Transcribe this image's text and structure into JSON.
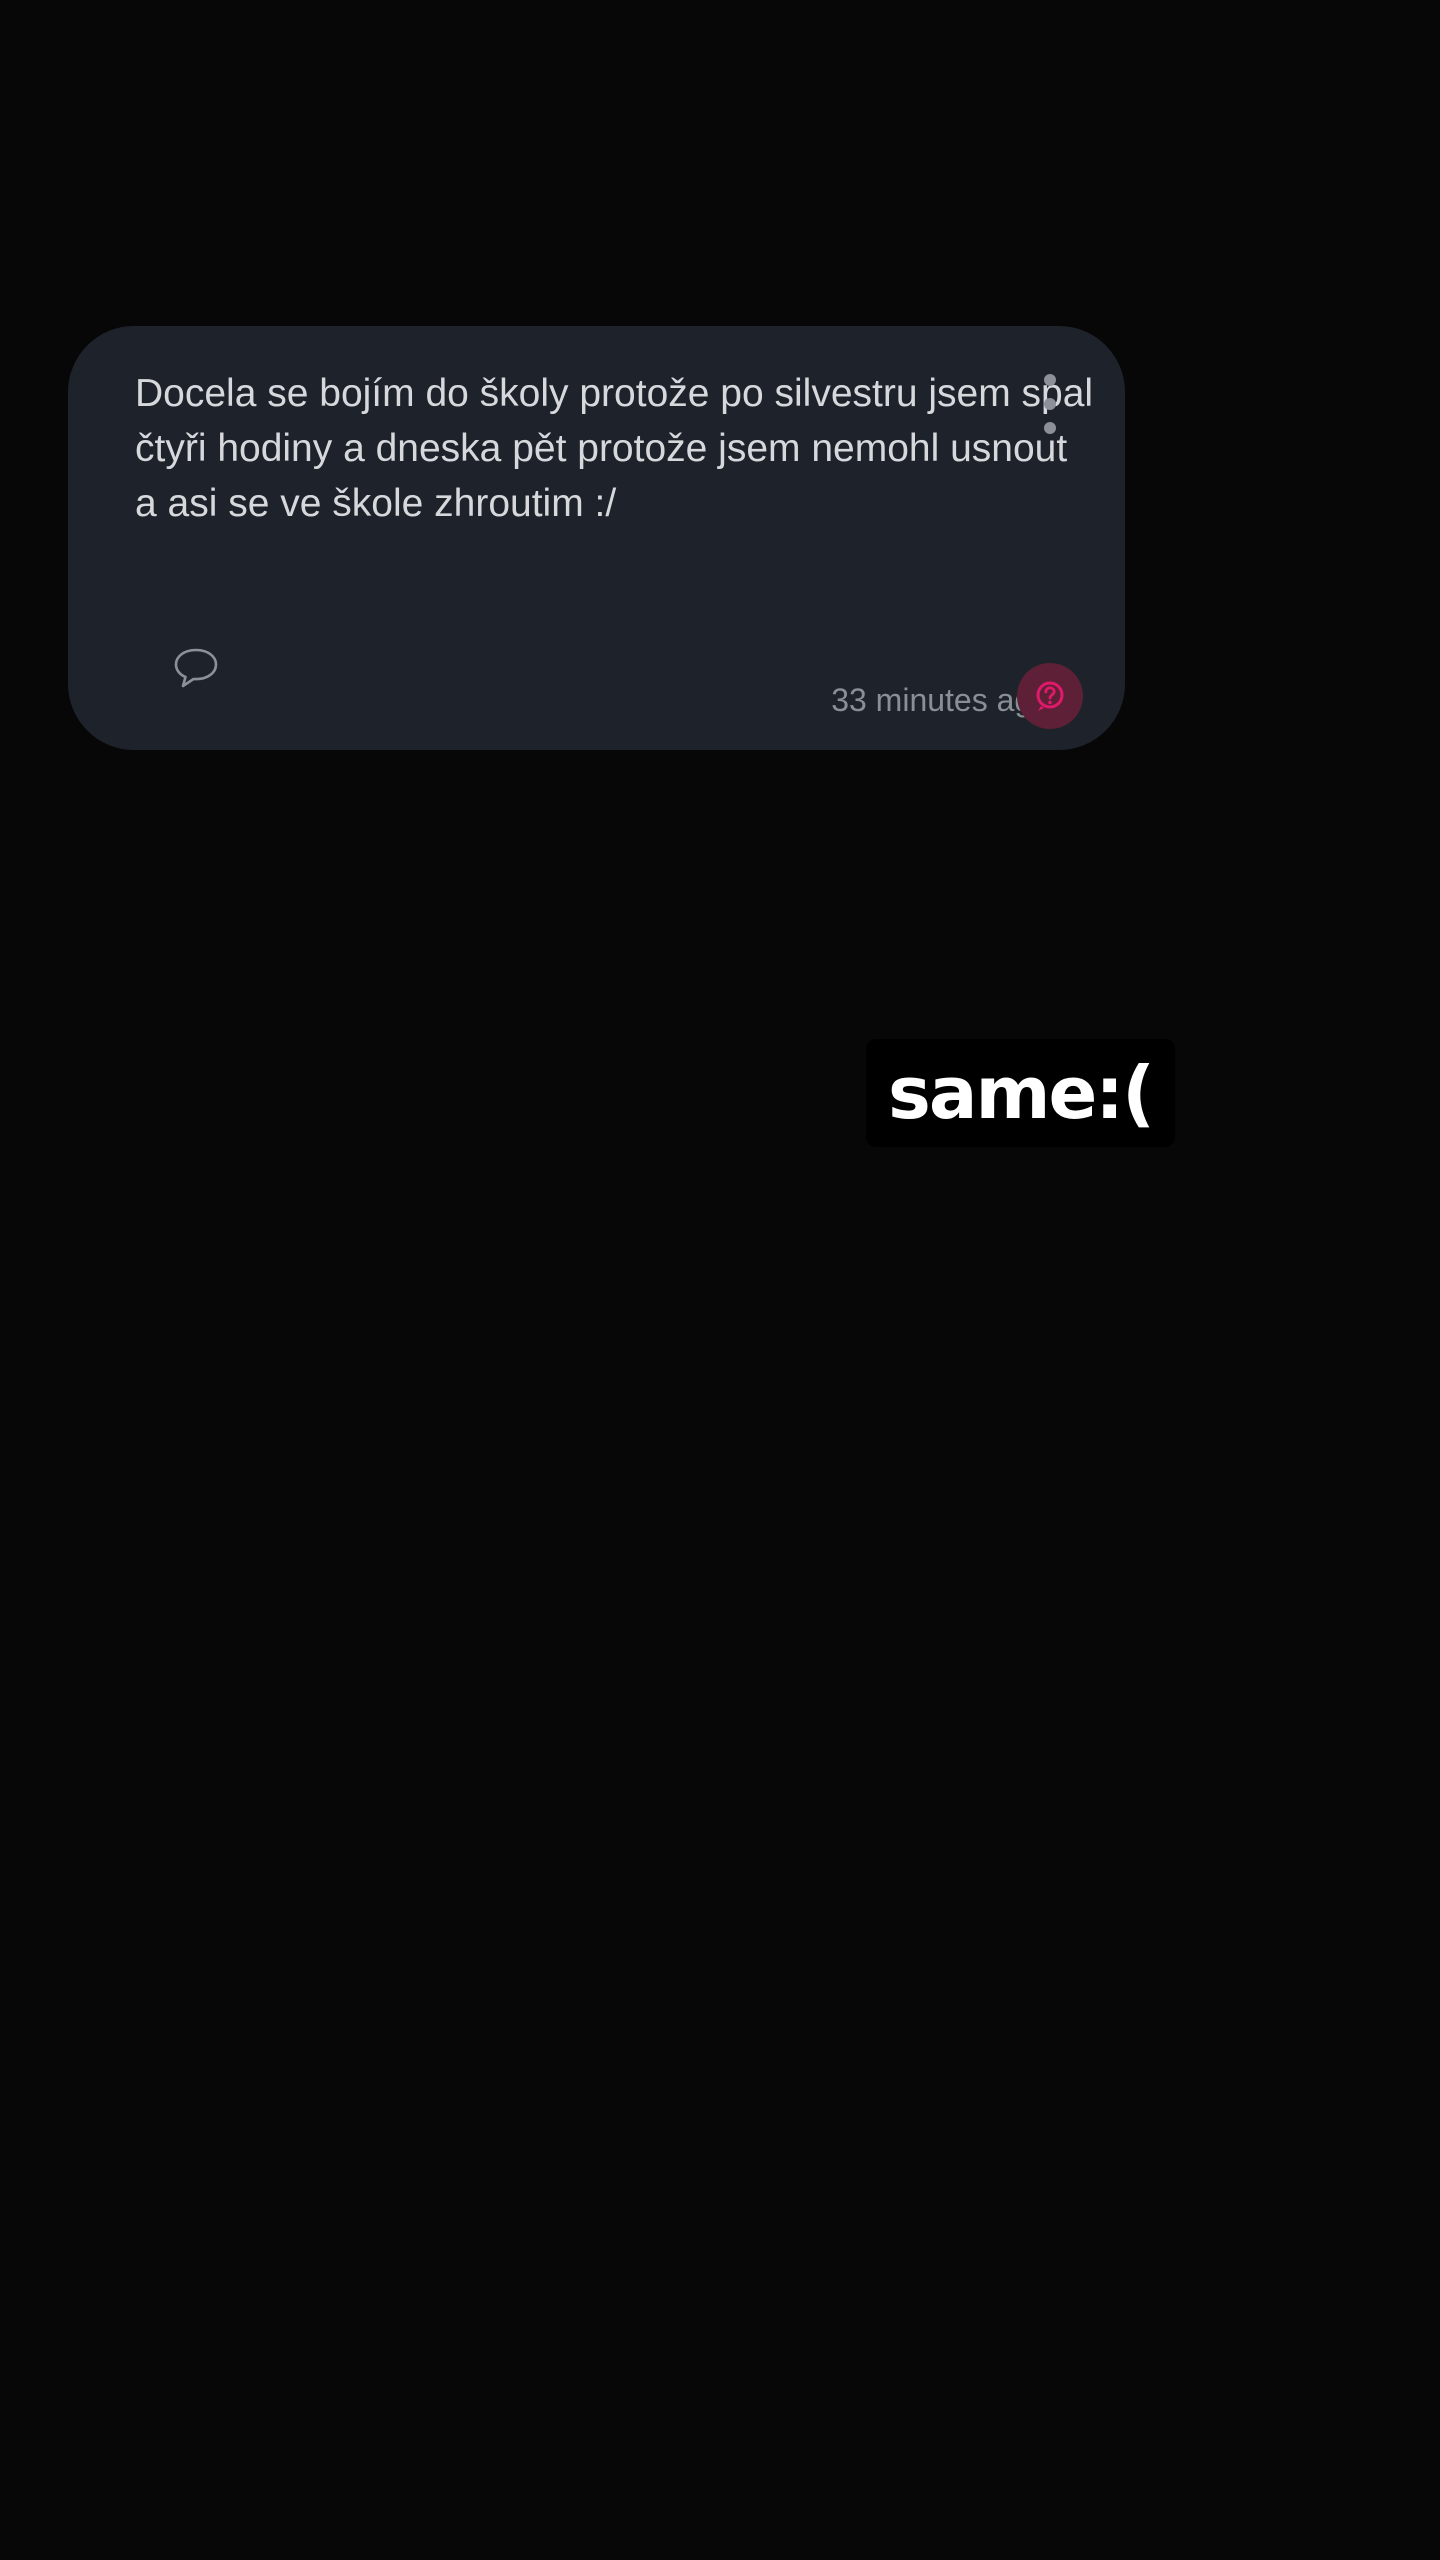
{
  "post": {
    "text": "Docela se bojím do školy protože po silvestru jsem spal čtyři hodiny a dneska pět protože jsem nemohl usnout a asi se ve škole zhroutim :/",
    "timestamp": "33 minutes ago",
    "icons": {
      "menu": "more-vertical-icon",
      "comment": "comment-bubble-icon",
      "help": "help-circle-icon"
    },
    "colors": {
      "card_background": "#1e232b",
      "text": "#d6d8dc",
      "help_accent": "#e0196a"
    }
  },
  "caption": {
    "text": "same:("
  }
}
